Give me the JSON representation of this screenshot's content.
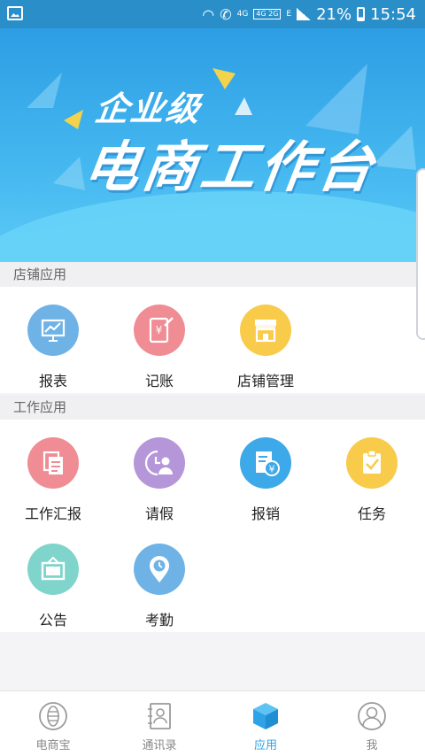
{
  "status_bar": {
    "network_label": "4G",
    "network_box": "4G 2G",
    "data_label": "E",
    "battery": "21%",
    "time": "15:54"
  },
  "banner": {
    "line1": "企业级",
    "line2": "电商工作台"
  },
  "sections": [
    {
      "title": "店铺应用",
      "items": [
        {
          "label": "报表",
          "icon": "chart-icon",
          "color": "#6fb3e6"
        },
        {
          "label": "记账",
          "icon": "account-book-icon",
          "color": "#f08c94"
        },
        {
          "label": "店铺管理",
          "icon": "store-icon",
          "color": "#f9cb4a"
        }
      ]
    },
    {
      "title": "工作应用",
      "items": [
        {
          "label": "工作汇报",
          "icon": "report-icon",
          "color": "#f08c94"
        },
        {
          "label": "请假",
          "icon": "leave-icon",
          "color": "#b596d8"
        },
        {
          "label": "报销",
          "icon": "reimburse-icon",
          "color": "#3ea9e8"
        },
        {
          "label": "任务",
          "icon": "task-icon",
          "color": "#f9cb4a"
        },
        {
          "label": "公告",
          "icon": "notice-icon",
          "color": "#7fd4cc"
        },
        {
          "label": "考勤",
          "icon": "attendance-icon",
          "color": "#6fb3e6"
        }
      ]
    }
  ],
  "tabs": [
    {
      "label": "电商宝",
      "icon": "shop-treasure-icon"
    },
    {
      "label": "通讯录",
      "icon": "contacts-icon"
    },
    {
      "label": "应用",
      "icon": "apps-cube-icon",
      "active": true
    },
    {
      "label": "我",
      "icon": "profile-icon"
    }
  ],
  "colors": {
    "accent": "#2ea2e6",
    "status_bar": "#2a8fc9"
  }
}
